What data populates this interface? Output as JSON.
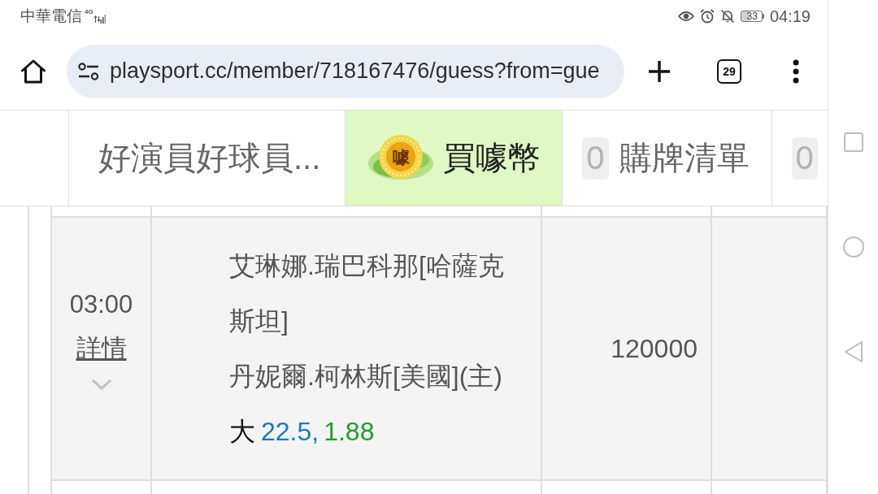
{
  "status_bar": {
    "carrier": "中華電信",
    "network_type": "4G",
    "battery": "33",
    "time": "04:19"
  },
  "browser": {
    "url": "playsport.cc/member/718167476/guess?from=gue",
    "tab_count": "29"
  },
  "tabs": [
    {
      "kind": "text",
      "label": "好演員好球員...",
      "selected": false
    },
    {
      "kind": "coin",
      "icon_text": "噱",
      "label": "買噱幣",
      "selected": true
    },
    {
      "kind": "count",
      "badge": "0",
      "label": "購牌清單",
      "selected": false
    },
    {
      "kind": "count",
      "badge": "0",
      "selected": false
    }
  ],
  "table": {
    "rows": [
      {
        "time": "03:00",
        "detail_link": "詳情",
        "expanded": false,
        "teams": [
          "艾琳娜.瑞巴科那[哈薩克斯坦]",
          "丹妮爾.柯林斯[美國](主)"
        ],
        "pick": {
          "side": "大",
          "line": "22.5,",
          "odds": "1.88"
        },
        "amount": "120000"
      }
    ]
  }
}
